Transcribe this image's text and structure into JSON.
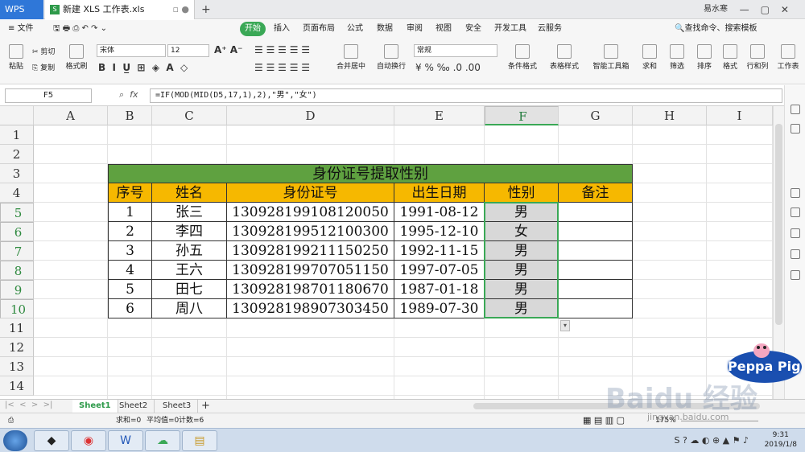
{
  "titlebar": {
    "app": "WPS",
    "file_tab": "新建 XLS 工作表.xls",
    "new_tab": "+",
    "user": "易水寒"
  },
  "menu": [
    "文件",
    "开始",
    "插入",
    "页面布局",
    "公式",
    "数据",
    "审阅",
    "视图",
    "安全",
    "开发工具",
    "云服务"
  ],
  "search_label": "查找命令、搜索模板",
  "toolbar": {
    "paste": "粘贴",
    "cut": "剪切",
    "copy": "复制",
    "format_painter": "格式刷",
    "font": "宋体",
    "size": "12",
    "merge": "合并居中",
    "wrap": "自动换行",
    "numfmt": "常规",
    "cond_format": "条件格式",
    "table_style": "表格样式",
    "smart_tools": "智能工具箱",
    "sum": "求和",
    "filter": "筛选",
    "sort": "排序",
    "format": "格式",
    "rowcol": "行和列",
    "worksheet": "工作表"
  },
  "namebox": "F5",
  "fx": "fx",
  "formula": "=IF(MOD(MID(D5,17,1),2),\"男\",\"女\")",
  "columns": [
    "A",
    "B",
    "C",
    "D",
    "E",
    "F",
    "G",
    "H",
    "I"
  ],
  "rows": [
    "1",
    "2",
    "3",
    "4",
    "5",
    "6",
    "7",
    "8",
    "9",
    "10",
    "11",
    "12",
    "13",
    "14"
  ],
  "table": {
    "title": "身份证号提取性别",
    "headers": [
      "序号",
      "姓名",
      "身份证号",
      "出生日期",
      "性别",
      "备注"
    ],
    "data": [
      [
        "1",
        "张三",
        "130928199108120050",
        "1991-08-12",
        "男",
        ""
      ],
      [
        "2",
        "李四",
        "130928199512100300",
        "1995-12-10",
        "女",
        ""
      ],
      [
        "3",
        "孙五",
        "130928199211150250",
        "1992-11-15",
        "男",
        ""
      ],
      [
        "4",
        "王六",
        "130928199707051150",
        "1997-07-05",
        "男",
        ""
      ],
      [
        "5",
        "田七",
        "130928198701180670",
        "1987-01-18",
        "男",
        ""
      ],
      [
        "6",
        "周八",
        "130928198907303450",
        "1989-07-30",
        "男",
        ""
      ]
    ]
  },
  "sheets": [
    "Sheet1",
    "Sheet2",
    "Sheet3"
  ],
  "status": {
    "sum": "求和=0",
    "avg": "平均值=0",
    "count": "计数=6",
    "zoom": "175%"
  },
  "clock": {
    "time": "9:31",
    "date": "2019/1/8"
  },
  "watermark": "Baidu 经验",
  "watermark_url": "jingyan.baidu.com",
  "peppa": "Peppa Pig",
  "colors": {
    "accent": "#3aa856",
    "title_fill": "#5fa140",
    "header_fill": "#f6b800",
    "selected_fill": "#d8d8d8"
  }
}
